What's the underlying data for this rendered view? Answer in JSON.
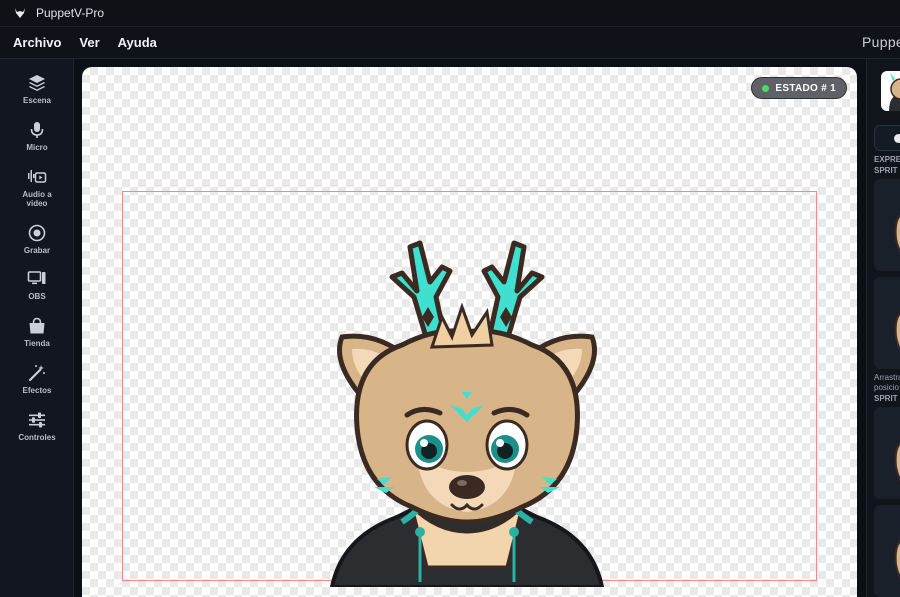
{
  "window": {
    "title": "PuppetV-Pro"
  },
  "menu": {
    "items": [
      "Archivo",
      "Ver",
      "Ayuda"
    ],
    "brand": "Puppe"
  },
  "sidebar": {
    "items": [
      {
        "label": "Escena",
        "icon": "layers-icon"
      },
      {
        "label": "Micro",
        "icon": "microphone-icon"
      },
      {
        "label": "Audio a video",
        "icon": "audio-video-icon"
      },
      {
        "label": "Grabar",
        "icon": "record-icon"
      },
      {
        "label": "OBS",
        "icon": "monitor-icon"
      },
      {
        "label": "Tienda",
        "icon": "shopping-bag-icon"
      },
      {
        "label": "Efectos",
        "icon": "magic-wand-icon"
      },
      {
        "label": "Controles",
        "icon": "sliders-icon"
      }
    ]
  },
  "canvas": {
    "state_badge": "ESTADO # 1",
    "state_color": "#4cd964",
    "frame_color": "#f08a8a"
  },
  "right_panel": {
    "section1": "EXPRE",
    "section1_line2": "SPRIT",
    "hint_line1": "Arrastra",
    "hint_line2": "posicio",
    "section2": "SPRIT"
  },
  "colors": {
    "accent": "#3fe0d0",
    "background": "#0d1117"
  }
}
